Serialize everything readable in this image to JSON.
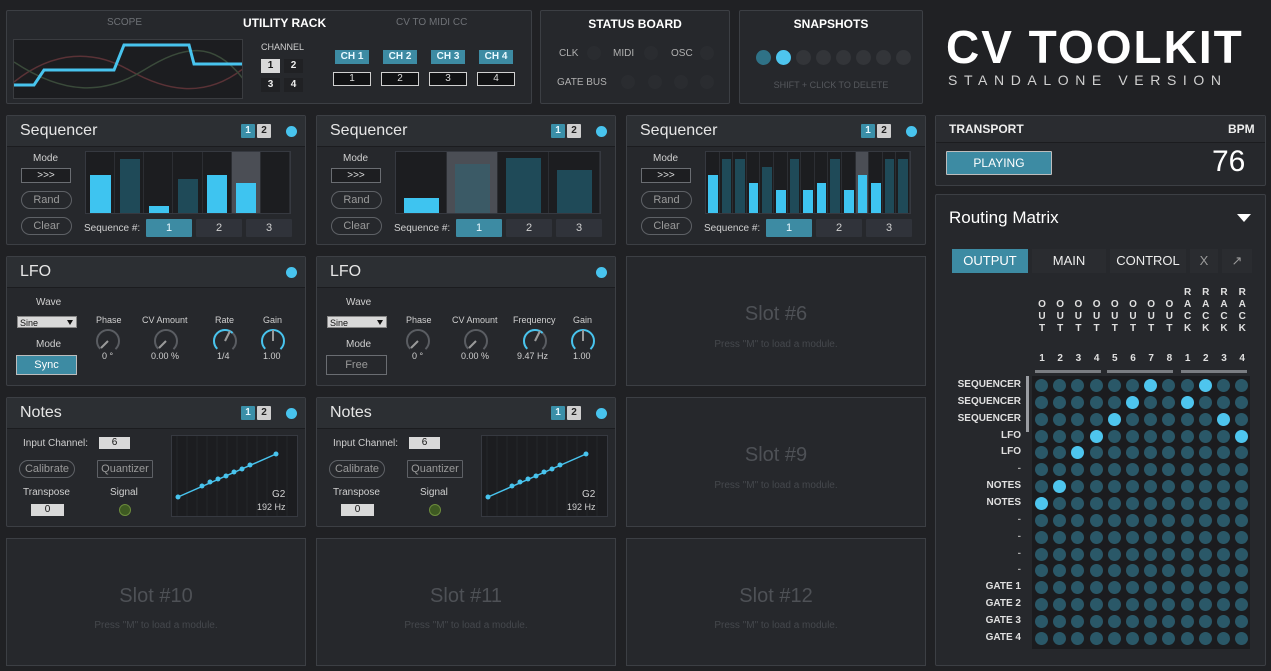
{
  "brand": {
    "title": "CV TOOLKIT",
    "subtitle": "STANDALONE VERSION"
  },
  "utility_rack": {
    "scope_label": "SCOPE",
    "title": "UTILITY RACK",
    "cv_to_midi_label": "CV TO MIDI CC",
    "channel_label": "CHANNEL",
    "channel_buttons": [
      "1",
      "2",
      "3",
      "4"
    ],
    "ch_buttons": [
      "CH 1",
      "CH 2",
      "CH 3",
      "CH 4"
    ],
    "ch_values": [
      "1",
      "2",
      "3",
      "4"
    ]
  },
  "status_board": {
    "title": "STATUS BOARD",
    "clk": "CLK",
    "midi": "MIDI",
    "osc": "OSC",
    "gate_bus": "GATE BUS"
  },
  "snapshots": {
    "title": "SNAPSHOTS",
    "hint": "SHIFT + CLICK TO DELETE"
  },
  "sequencers": [
    {
      "title": "Sequencer",
      "mode_label": "Mode",
      "mode_value": ">>>",
      "rand": "Rand",
      "clear": "Clear",
      "seq_label": "Sequence #:",
      "seqs": [
        "1",
        "2",
        "3"
      ],
      "page": [
        "1",
        "2"
      ]
    },
    {
      "title": "Sequencer",
      "mode_label": "Mode",
      "mode_value": ">>>",
      "rand": "Rand",
      "clear": "Clear",
      "seq_label": "Sequence #:",
      "seqs": [
        "1",
        "2",
        "3"
      ],
      "page": [
        "1",
        "2"
      ]
    },
    {
      "title": "Sequencer",
      "mode_label": "Mode",
      "mode_value": ">>>",
      "rand": "Rand",
      "clear": "Clear",
      "seq_label": "Sequence #:",
      "seqs": [
        "1",
        "2",
        "3"
      ],
      "page": [
        "1",
        "2"
      ]
    }
  ],
  "lfos": [
    {
      "title": "LFO",
      "wave_label": "Wave",
      "wave": "Sine",
      "mode_label": "Mode",
      "mode": "Sync",
      "phase_label": "Phase",
      "phase": "0 °",
      "cv_label": "CV Amount",
      "cv": "0.00 %",
      "rate_label": "Rate",
      "rate": "1/4",
      "gain_label": "Gain",
      "gain": "1.00"
    },
    {
      "title": "LFO",
      "wave_label": "Wave",
      "wave": "Sine",
      "mode_label": "Mode",
      "mode": "Free",
      "phase_label": "Phase",
      "phase": "0 °",
      "cv_label": "CV Amount",
      "cv": "0.00 %",
      "rate_label": "Frequency",
      "rate": "9.47 Hz",
      "gain_label": "Gain",
      "gain": "1.00"
    }
  ],
  "notes": [
    {
      "title": "Notes",
      "input_label": "Input Channel:",
      "input": "6",
      "calibrate": "Calibrate",
      "quantizer": "Quantizer",
      "transpose_label": "Transpose",
      "transpose": "0",
      "signal_label": "Signal",
      "note": "G2",
      "freq": "192 Hz",
      "page": [
        "1",
        "2"
      ]
    },
    {
      "title": "Notes",
      "input_label": "Input Channel:",
      "input": "6",
      "calibrate": "Calibrate",
      "quantizer": "Quantizer",
      "transpose_label": "Transpose",
      "transpose": "0",
      "signal_label": "Signal",
      "note": "G2",
      "freq": "192 Hz",
      "page": [
        "1",
        "2"
      ]
    }
  ],
  "slots": {
    "hint": "Press \"M\" to load a module.",
    "s6": "Slot #6",
    "s9": "Slot #9",
    "s10": "Slot #10",
    "s11": "Slot #11",
    "s12": "Slot #12"
  },
  "transport": {
    "label": "TRANSPORT",
    "bpm_label": "BPM",
    "state": "PLAYING",
    "bpm": "76"
  },
  "routing": {
    "title": "Routing Matrix",
    "tabs": [
      "OUTPUT",
      "MAIN",
      "CONTROL",
      "X",
      "↗"
    ],
    "col_letters": [
      [
        "O",
        "U",
        "T"
      ],
      [
        "O",
        "U",
        "T"
      ],
      [
        "O",
        "U",
        "T"
      ],
      [
        "O",
        "U",
        "T"
      ],
      [
        "O",
        "U",
        "T"
      ],
      [
        "O",
        "U",
        "T"
      ],
      [
        "O",
        "U",
        "T"
      ],
      [
        "O",
        "U",
        "T"
      ],
      [
        "R",
        "A",
        "C",
        "K"
      ],
      [
        "R",
        "A",
        "C",
        "K"
      ],
      [
        "R",
        "A",
        "C",
        "K"
      ],
      [
        "R",
        "A",
        "C",
        "K"
      ]
    ],
    "col_numbers": [
      "1",
      "2",
      "3",
      "4",
      "5",
      "6",
      "7",
      "8",
      "1",
      "2",
      "3",
      "4"
    ],
    "rows": [
      "SEQUENCER",
      "SEQUENCER",
      "SEQUENCER",
      "LFO",
      "LFO",
      "-",
      "NOTES",
      "NOTES",
      "-",
      "-",
      "-",
      "-",
      "GATE 1",
      "GATE 2",
      "GATE 3",
      "GATE 4"
    ],
    "active": [
      [
        0,
        6
      ],
      [
        0,
        9
      ],
      [
        1,
        5
      ],
      [
        1,
        8
      ],
      [
        2,
        4
      ],
      [
        2,
        10
      ],
      [
        3,
        3
      ],
      [
        3,
        11
      ],
      [
        4,
        2
      ],
      [
        6,
        1
      ],
      [
        7,
        0
      ]
    ]
  },
  "colors": {
    "accent": "#3d8ba3",
    "led": "#48c4ee",
    "bar": "#3ec4f0",
    "bar_dim": "#1f4a58"
  }
}
